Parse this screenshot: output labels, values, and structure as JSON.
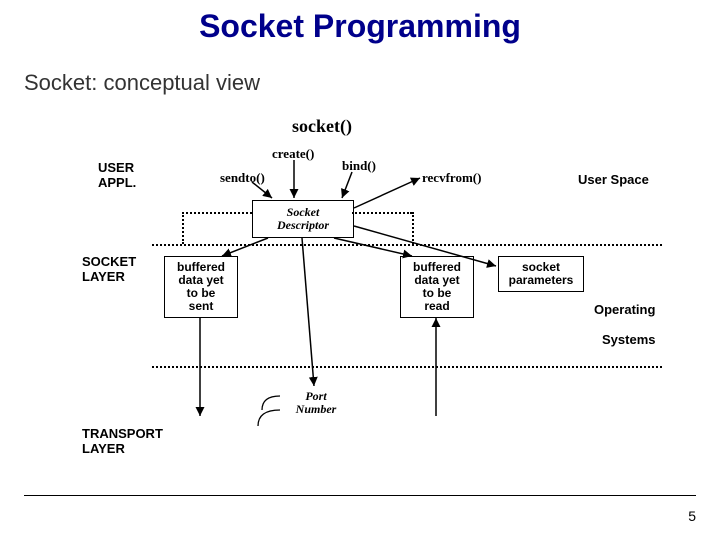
{
  "title": "Socket Programming",
  "subtitle": "Socket: conceptual view",
  "page_number": "5",
  "labels": {
    "socket_fn": "socket()",
    "create_fn": "create()",
    "bind_fn": "bind()",
    "sendto_fn": "sendto()",
    "recvfrom_fn": "recvfrom()",
    "user_appl": "USER\nAPPL.",
    "socket_layer": "SOCKET\nLAYER",
    "transport_layer": "TRANSPORT\nLAYER",
    "user_space": "User Space",
    "operating": "Operating",
    "systems": "Systems"
  },
  "boxes": {
    "socket_descriptor": "Socket\nDescriptor",
    "buffered_send": "buffered\ndata yet\nto be\nsent",
    "buffered_read": "buffered\ndata yet\nto be\nread",
    "socket_params": "socket\nparameters",
    "port_number": "Port\nNumber"
  }
}
